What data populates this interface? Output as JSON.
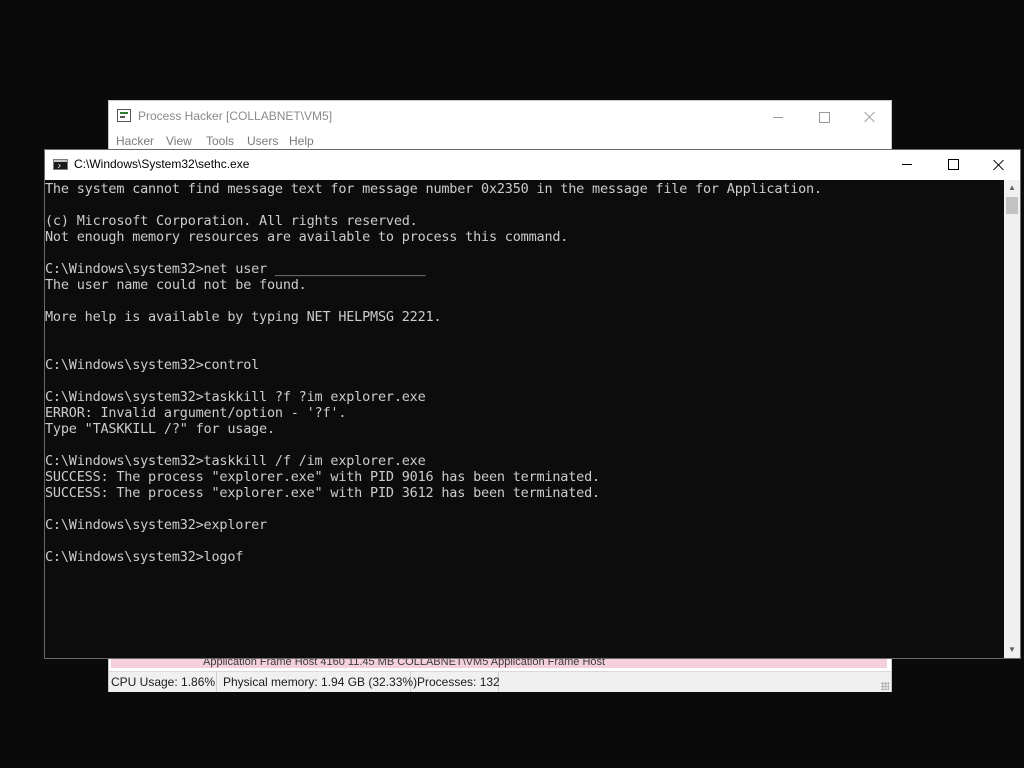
{
  "process_hacker": {
    "title": "Process Hacker [COLLABNET\\VM5]",
    "menu": [
      "Hacker",
      "View",
      "Tools",
      "Users",
      "Help"
    ],
    "row_fragment": "Application Frame Host    4160                              11.45 MB   COLLABNET\\VM5              Application Frame Host",
    "status": {
      "cpu": "CPU Usage: 1.86%",
      "memory": "Physical memory: 1.94 GB (32.33%)",
      "processes": "Processes: 132"
    }
  },
  "cmd": {
    "title": "C:\\Windows\\System32\\sethc.exe",
    "lines": [
      "The system cannot find message text for message number 0x2350 in the message file for Application.",
      "",
      "(c) Microsoft Corporation. All rights reserved.",
      "Not enough memory resources are available to process this command.",
      "",
      "C:\\Windows\\system32>net user ___________________",
      "The user name could not be found.",
      "",
      "More help is available by typing NET HELPMSG 2221.",
      "",
      "",
      "C:\\Windows\\system32>control",
      "",
      "C:\\Windows\\system32>taskkill ?f ?im explorer.exe",
      "ERROR: Invalid argument/option - '?f'.",
      "Type \"TASKKILL /?\" for usage.",
      "",
      "C:\\Windows\\system32>taskkill /f /im explorer.exe",
      "SUCCESS: The process \"explorer.exe\" with PID 9016 has been terminated.",
      "SUCCESS: The process \"explorer.exe\" with PID 3612 has been terminated.",
      "",
      "C:\\Windows\\system32>explorer",
      "",
      "C:\\Windows\\system32>logof"
    ]
  },
  "icons": {
    "ph_app": "process-hacker-app-icon",
    "cmd_app": "console-app-icon",
    "scroll_up": "▲",
    "scroll_down": "▼"
  }
}
